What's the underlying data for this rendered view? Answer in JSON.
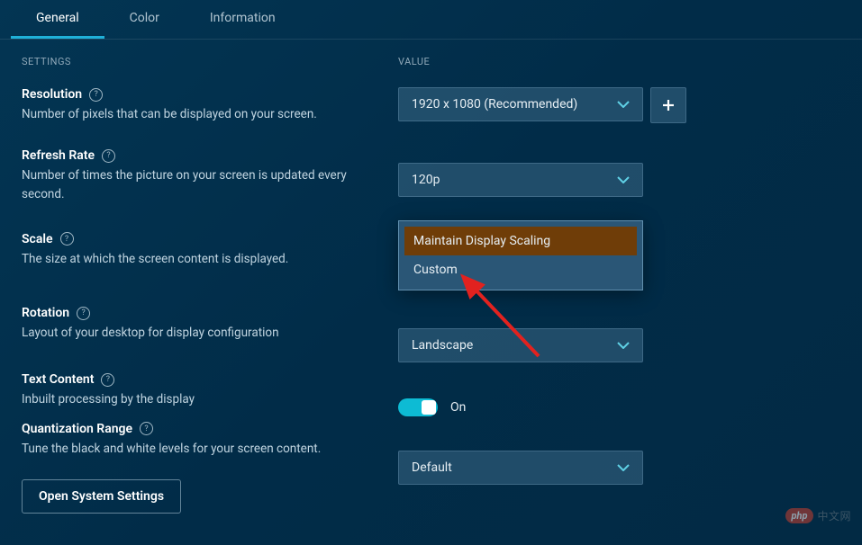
{
  "tabs": {
    "general": "General",
    "color": "Color",
    "information": "Information"
  },
  "headers": {
    "settings": "SETTINGS",
    "value": "VALUE"
  },
  "settings": {
    "resolution": {
      "title": "Resolution",
      "desc": "Number of pixels that can be displayed on your screen."
    },
    "refresh": {
      "title": "Refresh Rate",
      "desc": "Number of times the picture on your screen is updated every second."
    },
    "scale": {
      "title": "Scale",
      "desc": "The size at which the screen content is displayed."
    },
    "rotation": {
      "title": "Rotation",
      "desc": "Layout of your desktop for display configuration"
    },
    "text": {
      "title": "Text Content",
      "desc": "Inbuilt processing by the display"
    },
    "quant": {
      "title": "Quantization Range",
      "desc": "Tune the black and white levels for your screen content."
    }
  },
  "values": {
    "resolution": "1920 x 1080 (Recommended)",
    "refresh": "120p",
    "rotation": "Landscape",
    "quant": "Default",
    "textToggle": "On"
  },
  "scaleMenu": {
    "option1": "Maintain Display Scaling",
    "option2": "Custom"
  },
  "buttons": {
    "openSystem": "Open System Settings"
  },
  "watermark": {
    "badge": "php",
    "text": "中文网"
  }
}
